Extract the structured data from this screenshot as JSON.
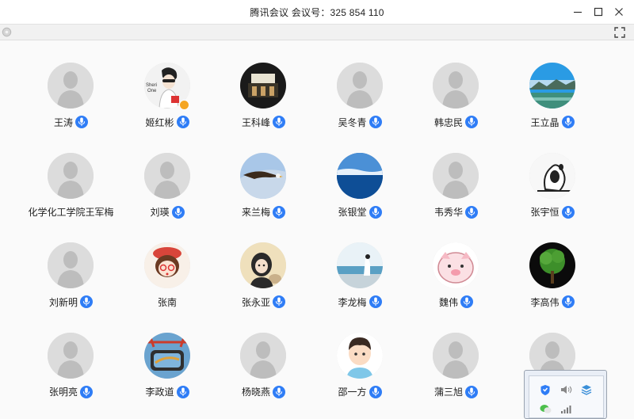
{
  "window": {
    "title": "腾讯会议 会议号：325 854 110",
    "min_label": "—",
    "max_label": "□",
    "close_label": "✕"
  },
  "accent_color": "#2f7df6",
  "participants": [
    {
      "name": "王涛",
      "mic": true
    },
    {
      "name": "姬红彬",
      "mic": true
    },
    {
      "name": "王科峰",
      "mic": true
    },
    {
      "name": "吴冬青",
      "mic": true
    },
    {
      "name": "韩忠民",
      "mic": true
    },
    {
      "name": "王立晶",
      "mic": true
    },
    {
      "name": "化学化工学院王军梅",
      "mic": false
    },
    {
      "name": "刘瑛",
      "mic": true
    },
    {
      "name": "来兰梅",
      "mic": true
    },
    {
      "name": "张银堂",
      "mic": true
    },
    {
      "name": "韦秀华",
      "mic": true
    },
    {
      "name": "张宇恒",
      "mic": true
    },
    {
      "name": "刘新明",
      "mic": true
    },
    {
      "name": "张南",
      "mic": false
    },
    {
      "name": "张永亚",
      "mic": true
    },
    {
      "name": "李龙梅",
      "mic": true
    },
    {
      "name": "魏伟",
      "mic": true
    },
    {
      "name": "李高伟",
      "mic": true
    },
    {
      "name": "张明亮",
      "mic": true
    },
    {
      "name": "李政道",
      "mic": true
    },
    {
      "name": "杨晓燕",
      "mic": true
    },
    {
      "name": "邵一方",
      "mic": true
    },
    {
      "name": "蒲三旭",
      "mic": true
    },
    {
      "name": "",
      "mic": false
    }
  ],
  "tray_icons": [
    "shield-icon",
    "volume-icon",
    "layers-icon",
    "wechat-icon",
    "signal-icon"
  ]
}
